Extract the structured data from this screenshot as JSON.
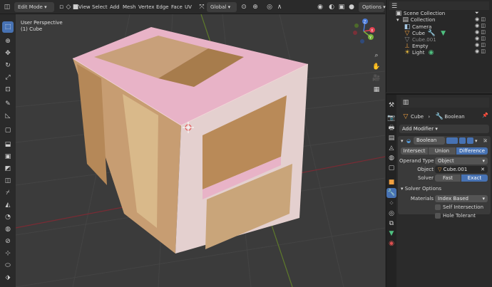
{
  "header": {
    "mode_label": "Edit Mode",
    "menus": [
      "View",
      "Select",
      "Add",
      "Mesh",
      "Vertex",
      "Edge",
      "Face",
      "UV"
    ],
    "orientation_label": "Global",
    "options_label": "Options"
  },
  "viewport": {
    "view_name": "User Perspective",
    "object_name": "(1) Cube",
    "gizmo_axes": [
      "X",
      "Y",
      "Z"
    ]
  },
  "outliner": {
    "root": "Scene Collection",
    "collection": "Collection",
    "items": [
      "Camera",
      "Cube",
      "Cube.001",
      "Empty",
      "Light"
    ]
  },
  "properties": {
    "breadcrumb_object": "Cube",
    "breadcrumb_modifier": "Boolean",
    "add_modifier_label": "Add Modifier",
    "modifier_name": "Boolean",
    "operations": [
      "Intersect",
      "Union",
      "Difference"
    ],
    "active_operation": "Difference",
    "operand_type_label": "Operand Type",
    "operand_type_value": "Object",
    "object_label": "Object",
    "object_value": "Cube.001",
    "solver_label": "Solver",
    "solvers": [
      "Fast",
      "Exact"
    ],
    "active_solver": "Exact",
    "solver_options_label": "Solver Options",
    "materials_label": "Materials",
    "materials_value": "Index Based",
    "self_intersection_label": "Self Intersection",
    "hole_tolerant_label": "Hole Tolerant"
  },
  "colors": {
    "accent": "#4772b3",
    "cube_pink": "#e8b3c7"
  }
}
